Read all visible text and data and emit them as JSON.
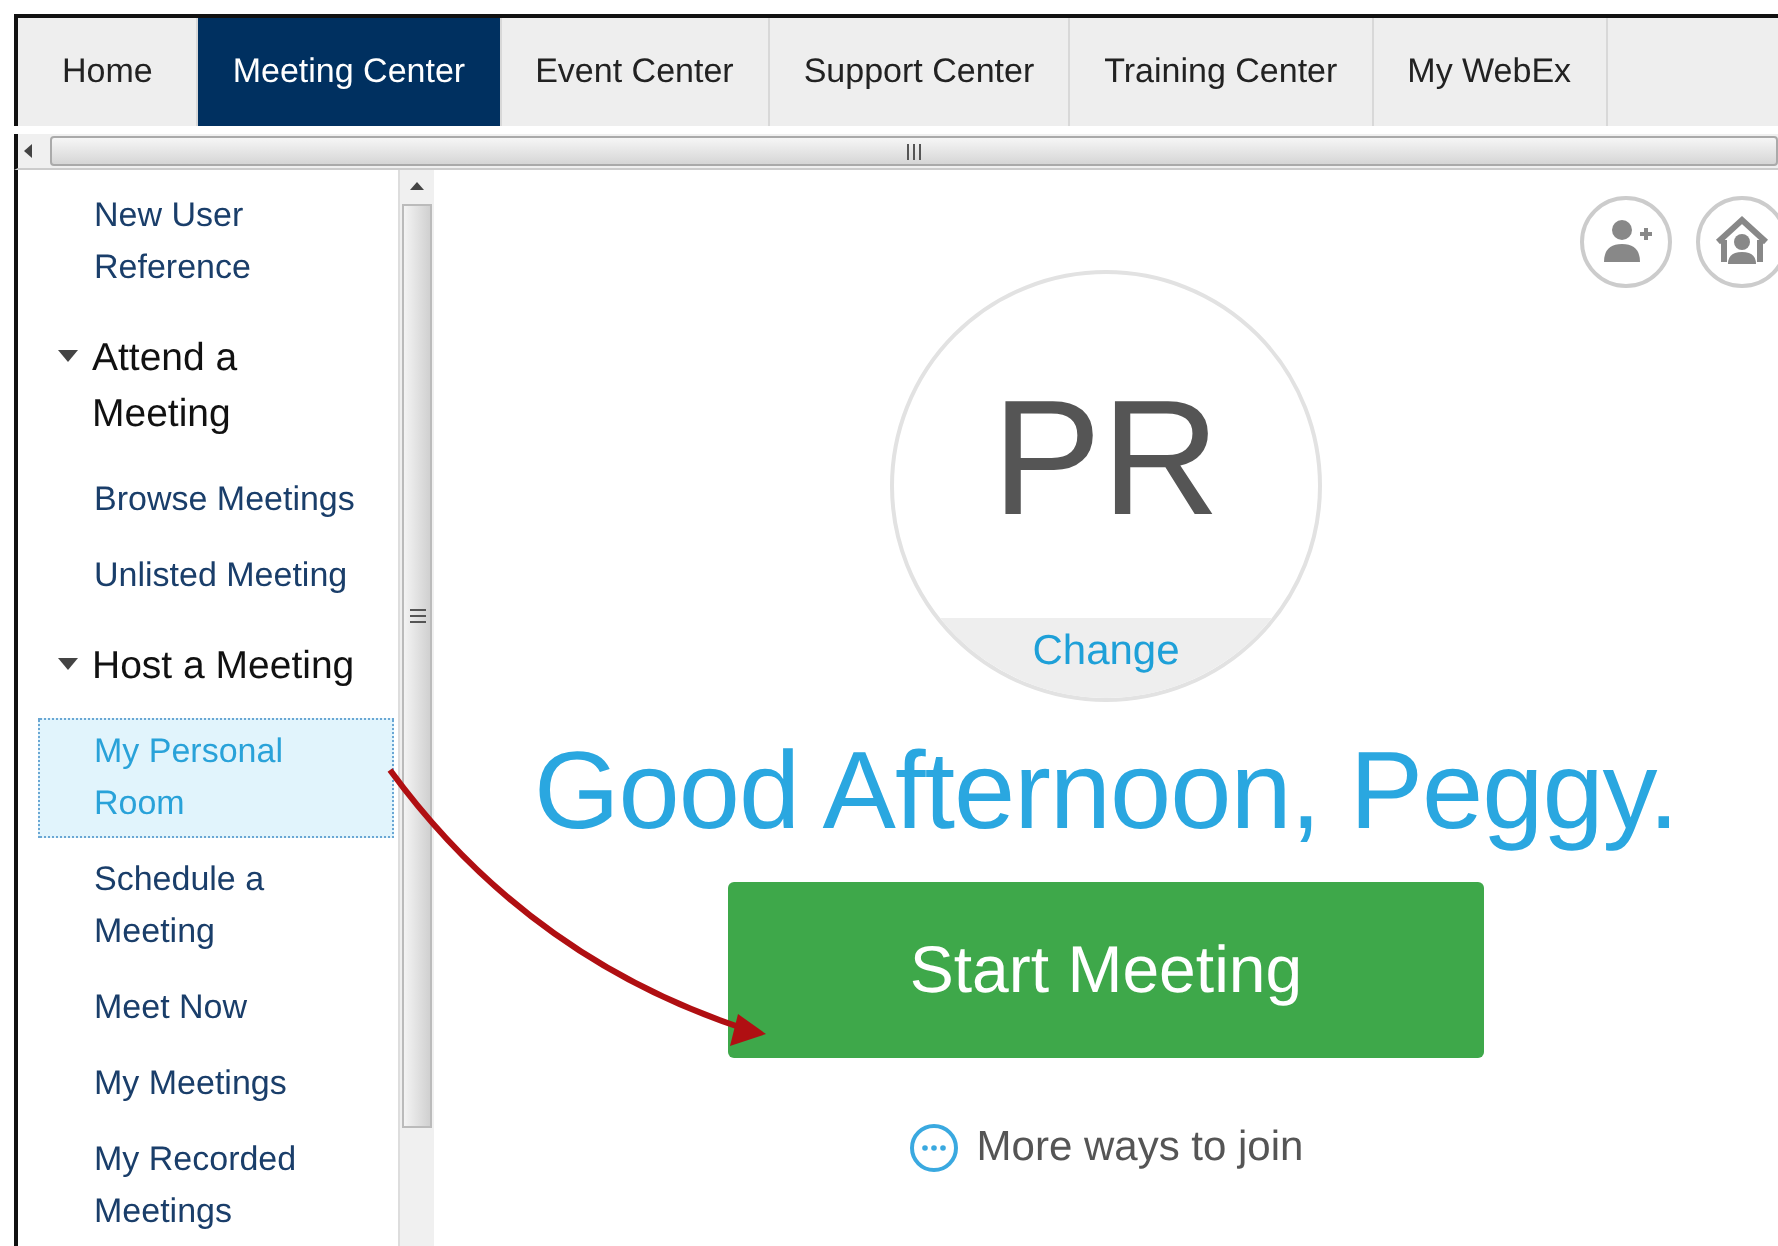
{
  "tabs": [
    {
      "label": "Home",
      "selected": false
    },
    {
      "label": "Meeting Center",
      "selected": true
    },
    {
      "label": "Event Center",
      "selected": false
    },
    {
      "label": "Support Center",
      "selected": false
    },
    {
      "label": "Training Center",
      "selected": false
    },
    {
      "label": "My WebEx",
      "selected": false
    }
  ],
  "sidebar": {
    "items": [
      {
        "kind": "link",
        "label": "New User Reference",
        "selected": false
      },
      {
        "kind": "section",
        "label": "Attend a Meeting",
        "expanded": true,
        "children": [
          {
            "label": "Browse Meetings",
            "selected": false
          },
          {
            "label": "Unlisted Meeting",
            "selected": false
          }
        ]
      },
      {
        "kind": "section",
        "label": "Host a Meeting",
        "expanded": true,
        "children": [
          {
            "label": "My Personal Room",
            "selected": true
          },
          {
            "label": "Schedule a Meeting",
            "selected": false
          },
          {
            "label": "Meet Now",
            "selected": false
          },
          {
            "label": "My Meetings",
            "selected": false
          },
          {
            "label": "My Recorded Meetings",
            "selected": false
          }
        ]
      }
    ]
  },
  "main": {
    "avatar_initials": "PR",
    "avatar_action": "Change",
    "greeting": "Good Afternoon, Peggy.",
    "start_button": "Start Meeting",
    "more_link": "More ways to join"
  }
}
